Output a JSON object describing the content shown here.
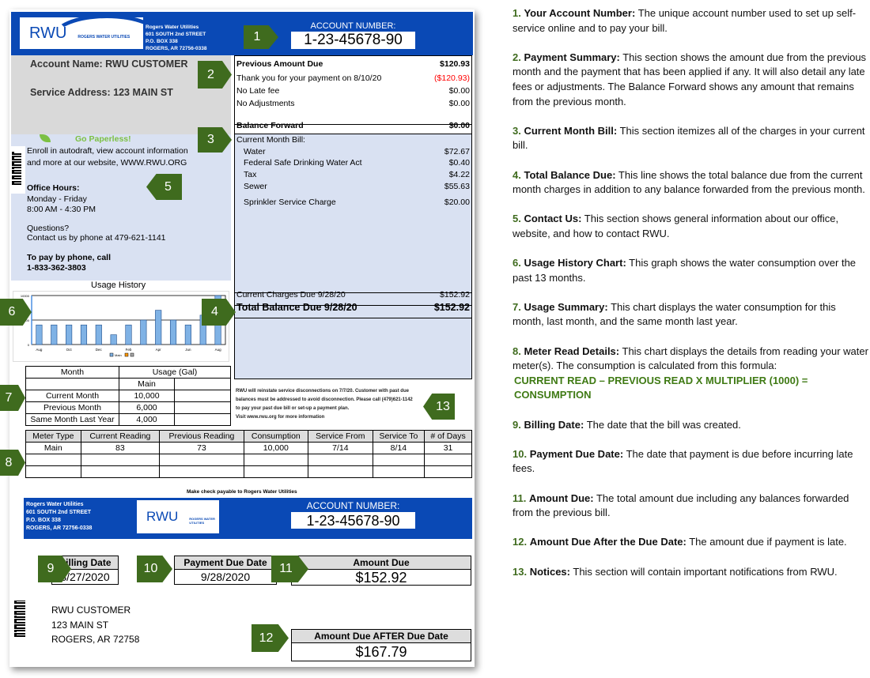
{
  "bill": {
    "utility_name": "Rogers Water Utilities",
    "logo_text": "RWU",
    "logo_tagline": "ROGERS WATER UTILITIES",
    "address": [
      "601 SOUTH 2nd STREET",
      "P.O. BOX 338",
      "ROGERS, AR 72756-0338"
    ],
    "account_label": "ACCOUNT NUMBER:",
    "account_number": "1-23-45678-90",
    "account_name": "Account Name: RWU CUSTOMER",
    "service_address": "Service Address: 123 MAIN ST",
    "paperless": "Go Paperless!",
    "contact": {
      "enroll1": "Enroll in autodraft, view account information",
      "enroll2": "and more at our website, WWW.RWU.ORG",
      "hours_title": "Office Hours:",
      "days": "Monday - Friday",
      "hours": "8:00 AM - 4:30 PM",
      "questions": "Questions?",
      "phone_line": "Contact us by phone at 479-621-1141",
      "pay_title": "To pay by phone, call",
      "pay_phone": "1-833-362-3803"
    },
    "summary": {
      "previous": {
        "label": "Previous Amount Due",
        "amount": "$120.93"
      },
      "payment": {
        "label": "Thank you for your payment on 8/10/20",
        "amount": "($120.93)"
      },
      "late": {
        "label": "No Late fee",
        "amount": "$0.00"
      },
      "adjust": {
        "label": "No Adjustments",
        "amount": "$0.00"
      },
      "balance": {
        "label": "Balance Forward",
        "amount": "$0.00"
      },
      "current_title": "Current Month Bill:",
      "charges": [
        {
          "label": "Water",
          "amount": "$72.67"
        },
        {
          "label": "Federal Safe Drinking Water Act",
          "amount": "$0.40"
        },
        {
          "label": "Tax",
          "amount": "$4.22"
        },
        {
          "label": "Sewer",
          "amount": "$55.63"
        },
        {
          "label": "Sprinkler Service Charge",
          "amount": "$20.00"
        }
      ],
      "current_due": {
        "label": "Current Charges Due 9/28/20",
        "amount": "$152.92"
      },
      "total": {
        "label": "Total Balance Due 9/28/20",
        "amount": "$152.92"
      }
    },
    "notice": {
      "l1": "RWU will reinstate service disconnections on 7/7/20. Customer with past due",
      "l2": "balances must be addressed to avoid disconnection. Please call (479)621-1142",
      "l3": "to pay your past due bill or set-up a payment plan.",
      "l4": "Visit www.rwu.org for more information"
    },
    "chart_data": {
      "type": "bar",
      "title": "Usage History",
      "categories": [
        "Aug",
        "Sep",
        "Oct",
        "Nov",
        "Dec",
        "Jan",
        "Feb",
        "Mar",
        "Apr",
        "May",
        "Jun",
        "Jul",
        "Aug"
      ],
      "tick_labels": [
        "Aug",
        "Oct",
        "Dec",
        "Feb",
        "Apr",
        "Jun",
        "Aug"
      ],
      "series": [
        {
          "name": "Main",
          "values": [
            4000,
            4000,
            4000,
            4000,
            4000,
            2000,
            4000,
            5000,
            7000,
            5000,
            4000,
            6000,
            10000
          ]
        }
      ],
      "yticks": [
        "0",
        "5000",
        "10000"
      ],
      "ylim": [
        0,
        10000
      ],
      "color": "#7fb2e5",
      "legend": "bottom"
    },
    "usage": {
      "h_month": "Month",
      "h_usage": "Usage (Gal)",
      "h_main": "Main",
      "rows": [
        {
          "label": "Current Month",
          "value": "10,000"
        },
        {
          "label": "Previous Month",
          "value": "6,000"
        },
        {
          "label": "Same Month Last Year",
          "value": "4,000"
        }
      ]
    },
    "meter": {
      "headers": [
        "Meter Type",
        "Current Reading",
        "Previous Reading",
        "Consumption",
        "Service From",
        "Service To",
        "# of Days"
      ],
      "row": [
        "Main",
        "83",
        "73",
        "10,000",
        "7/14",
        "8/14",
        "31"
      ]
    },
    "check_payable": "Make check payable to Rogers Water Utilities",
    "billing_date": {
      "label": "Billing Date",
      "value": "8/27/2020"
    },
    "due_date": {
      "label": "Payment Due Date",
      "value": "9/28/2020"
    },
    "amount_due": {
      "label": "Amount Due",
      "value": "$152.92"
    },
    "after_due": {
      "label": "Amount Due AFTER Due Date",
      "value": "$167.79"
    },
    "mail": [
      "RWU CUSTOMER",
      "123 MAIN ST",
      "ROGERS, AR 72758"
    ],
    "markers": [
      "1",
      "2",
      "3",
      "4",
      "5",
      "6",
      "7",
      "8",
      "9",
      "10",
      "11",
      "12",
      "13"
    ],
    "colors": {
      "brand_blue": "#0a49b5",
      "marker_green": "#3f6b1e",
      "panel_gray": "#d9d9d9",
      "panel_blue": "#d9e1f2",
      "negative_red": "#ff0000"
    }
  },
  "notes": [
    {
      "n": "1.",
      "title": "Your Account Number:",
      "text": " The unique account number used to set up self-service online and to pay your bill."
    },
    {
      "n": "2.",
      "title": "Payment Summary:",
      "text": " This section shows the amount due from the previous month and the payment that has been applied if any. It will also detail any late fees or adjustments. The Balance Forward shows any amount that remains from the previous month."
    },
    {
      "n": "3.",
      "title": "Current Month Bill:",
      "text": " This section itemizes all of the charges in your current bill."
    },
    {
      "n": "4.",
      "title": "Total Balance Due:",
      "text": " This line shows the total balance due from the current month charges in addition to any balance forwarded from the previous month."
    },
    {
      "n": "5.",
      "title": "Contact Us:",
      "text": " This section shows general information about our office, website, and how to contact RWU."
    },
    {
      "n": "6.",
      "title": "Usage History Chart:",
      "text": " This graph shows the water consumption over the past 13 months."
    },
    {
      "n": "7.",
      "title": "Usage Summary:",
      "text": " This chart displays the water consumption for this month, last month, and the same month last year."
    },
    {
      "n": "8.",
      "title": "Meter Read Details:",
      "text": " This chart displays the details from reading your water meter(s). The consumption is calculated from this formula:",
      "formula": "CURRENT READ – PREVIOUS READ X MULTIPLIER (1000) = CONSUMPTION"
    },
    {
      "n": "9.",
      "title": "Billing Date:",
      "text": " The date that the bill was created."
    },
    {
      "n": "10.",
      "title": "Payment Due Date:",
      "text": " The date that payment is due before incurring late fees."
    },
    {
      "n": "11.",
      "title": "Amount Due:",
      "text": " The total amount due including any balances forwarded from the previous bill."
    },
    {
      "n": "12.",
      "title": "Amount Due After the Due Date:",
      "text": " The amount due if payment is late."
    },
    {
      "n": "13.",
      "title": "Notices:",
      "text": " This section will contain important notifications from RWU."
    }
  ]
}
